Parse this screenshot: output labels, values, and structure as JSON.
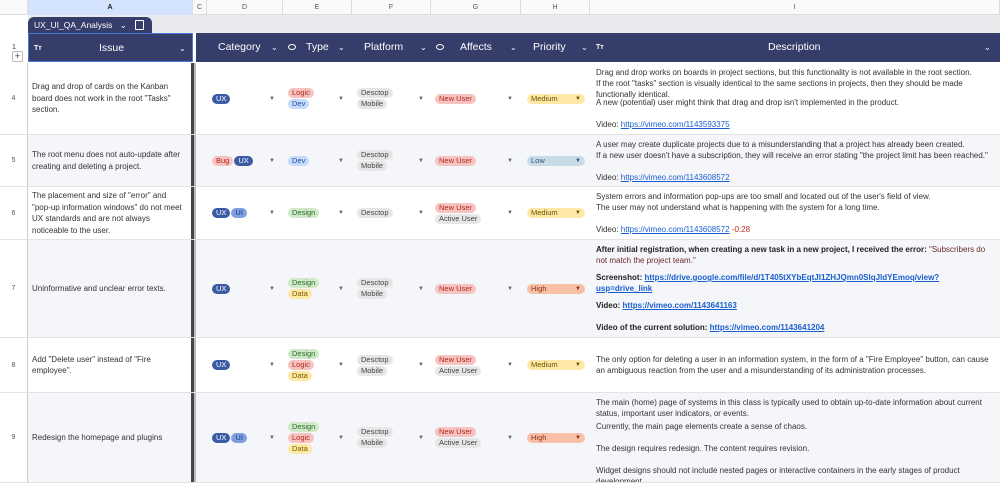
{
  "columns": [
    "A",
    "C",
    "D",
    "E",
    "F",
    "G",
    "H",
    "I"
  ],
  "sheet_tab": {
    "label": "UX_UI_QA_Analysis",
    "chevron": "⌄"
  },
  "header": {
    "row_number": "1",
    "issue": "Issue",
    "category": "Category",
    "type": "Type",
    "platform": "Platform",
    "affects": "Affects",
    "priority": "Priority",
    "description": "Description",
    "text_icon": "Tт",
    "add": "+"
  },
  "colors": {
    "header_bg": "#353d6b",
    "UX": "#3b5ba5",
    "UI": "#7fa0e0",
    "Bug": "#f6c3c0",
    "Logic": "#f6c3c0",
    "Dev": "#c6dafc",
    "Design": "#cfe8c8",
    "Data": "#fde8a6",
    "Desctop": "#e6e6e6",
    "Mobile": "#e6e6e6",
    "New User": "#f6c3c0",
    "Active User": "#e6e6e6",
    "Medium": "#fde8a6",
    "Low": "#c9dbe6",
    "High": "#f9c0a8"
  },
  "rows": [
    {
      "num": "4",
      "issue": "Drag and drop of cards on the Kanban board does not work in the root \"Tasks\" section.",
      "category": [
        "UX"
      ],
      "type": [
        "Logic",
        "Dev"
      ],
      "platform": [
        "Desctop",
        "Mobile"
      ],
      "affects": [
        "New User"
      ],
      "priority": "Medium",
      "description": [
        [
          {
            "t": "Drag and drop works on boards in project sections, but this functionality is not available in the root section."
          }
        ],
        [
          {
            "t": "If the root \"tasks\" section is visually identical to the same sections in projects, then they should be made functionally identical."
          }
        ],
        [
          {
            "t": "A new (potential) user might think that drag and drop isn't implemented in the product."
          }
        ],
        [],
        [
          {
            "t": "Video: "
          },
          {
            "t": "https://vimeo.com/1143593375",
            "link": true
          }
        ]
      ]
    },
    {
      "num": "5",
      "issue": "The root menu does not auto-update after creating and deleting a project.",
      "category": [
        "Bug",
        "UX"
      ],
      "type": [
        "Dev"
      ],
      "platform": [
        "Desctop",
        "Mobile"
      ],
      "affects": [
        "New User"
      ],
      "priority": "Low",
      "description": [
        [
          {
            "t": "A user may create duplicate projects due to a misunderstanding that a project has already been created."
          }
        ],
        [
          {
            "t": "If a new user doesn't have a subscription, they will receive an error stating \"the project limit has been reached.\""
          }
        ],
        [],
        [
          {
            "t": "Video: "
          },
          {
            "t": "https://vimeo.com/1143608572",
            "link": true
          }
        ]
      ]
    },
    {
      "num": "6",
      "issue": "The placement and size of \"error\" and \"pop-up information windows\" do not meet UX standards and are not always noticeable to the user.",
      "category": [
        "UX",
        "UI"
      ],
      "type": [
        "Design"
      ],
      "platform": [
        "Desctop"
      ],
      "affects": [
        "New User",
        "Active User"
      ],
      "priority": "Medium",
      "description": [
        [
          {
            "t": "System errors and information pop-ups are too small and located out of the user's field of view."
          }
        ],
        [
          {
            "t": "The user may not understand what is happening with the system for a long time."
          }
        ],
        [],
        [
          {
            "t": "Video: "
          },
          {
            "t": "https://vimeo.com/1143608572",
            "link": true
          },
          {
            "t": " -0:28",
            "red": true
          }
        ]
      ]
    },
    {
      "num": "7",
      "issue": "Uninformative and unclear error texts.",
      "category": [
        "UX"
      ],
      "type": [
        "Design",
        "Data"
      ],
      "platform": [
        "Desctop",
        "Mobile"
      ],
      "affects": [
        "New User"
      ],
      "priority": "High",
      "bold": true,
      "description": [
        [
          {
            "t": "After initial registration, when creating a new task in a new project, I received the error: "
          },
          {
            "t": "\"Subscribers do not match the project team.\"",
            "q": true
          }
        ],
        [],
        [
          {
            "t": "Screenshot: "
          },
          {
            "t": "https://drive.google.com/file/d/1T405tXYbEqtJI1ZHJQmn0SlqJldYEmoq/view?usp=drive_link",
            "link": true
          }
        ],
        [],
        [
          {
            "t": "Video: "
          },
          {
            "t": "https://vimeo.com/1143641163",
            "link": true
          }
        ],
        [],
        [
          {
            "t": "Video of the current solution: "
          },
          {
            "t": "https://vimeo.com/1143641204",
            "link": true
          }
        ]
      ]
    },
    {
      "num": "8",
      "issue": "Add \"Delete user\" instead of \"Fire employee\".",
      "category": [
        "UX"
      ],
      "type": [
        "Design",
        "Logic",
        "Data"
      ],
      "platform": [
        "Desctop",
        "Mobile"
      ],
      "affects": [
        "New User",
        "Active User"
      ],
      "priority": "Medium",
      "description": [
        [
          {
            "t": "The only option for deleting a user in an information system, in the form of a \"Fire Employee\" button, can cause an ambiguous reaction from the user and a misunderstanding of its administration processes."
          }
        ]
      ]
    },
    {
      "num": "9",
      "issue": "Redesign the homepage and plugins",
      "category": [
        "UX",
        "UI"
      ],
      "type": [
        "Design",
        "Logic",
        "Data"
      ],
      "platform": [
        "Desctop",
        "Mobile"
      ],
      "affects": [
        "New User",
        "Active User"
      ],
      "priority": "High",
      "description": [
        [
          {
            "t": "The main (home) page of systems in this class is typically used to obtain up-to-date information about current status, important user indicators, or events."
          }
        ],
        [],
        [
          {
            "t": "Currently, the main page elements create a sense of chaos."
          }
        ],
        [],
        [
          {
            "t": "The design requires redesign. The content requires revision."
          }
        ],
        [],
        [
          {
            "t": "Widget designs should not include nested pages or interactive containers in the early stages of product development."
          }
        ]
      ]
    }
  ]
}
